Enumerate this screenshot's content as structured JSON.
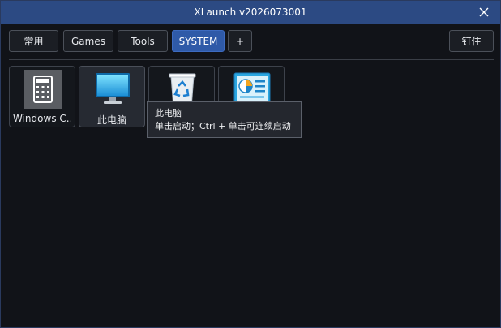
{
  "window": {
    "title": "XLaunch v2026073001"
  },
  "tabs": [
    {
      "label": "常用",
      "active": false
    },
    {
      "label": "Games",
      "active": false
    },
    {
      "label": "Tools",
      "active": false
    },
    {
      "label": "SYSTEM",
      "active": true
    },
    {
      "label": "+",
      "active": false
    }
  ],
  "pin_label": "钉住",
  "items": [
    {
      "label": "Windows C...",
      "icon": "calculator-icon"
    },
    {
      "label": "此电脑",
      "icon": "monitor-icon"
    },
    {
      "label": "",
      "icon": "recycle-bin-icon"
    },
    {
      "label": "",
      "icon": "control-panel-icon"
    }
  ],
  "tooltip": {
    "line1": "此电脑",
    "line2": "单击启动；Ctrl + 单击可连续启动"
  },
  "colors": {
    "titlebar": "#2c4a83",
    "active_tab": "#2f5aa8",
    "background": "#111318"
  }
}
